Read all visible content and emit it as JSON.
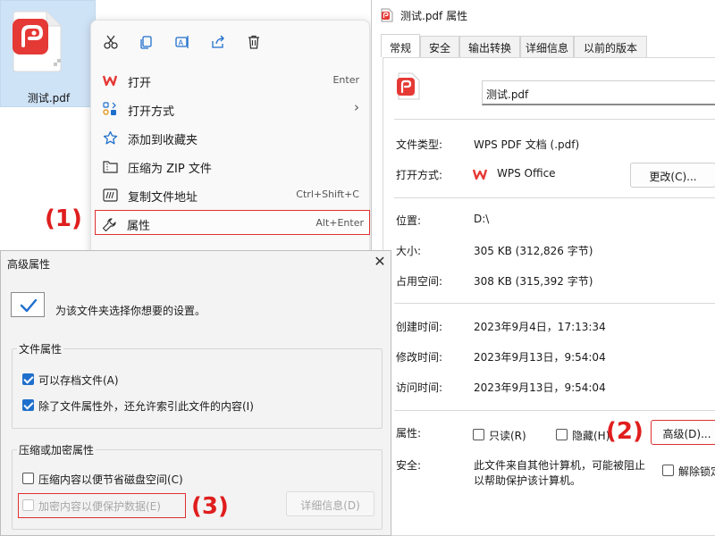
{
  "desktop": {
    "file_name": "测试.pdf"
  },
  "context_menu": {
    "toolbar_icons": [
      "cut-icon",
      "copy-icon",
      "rename-icon",
      "share-icon",
      "delete-icon"
    ],
    "items": [
      {
        "label": "打开",
        "shortcut": "Enter",
        "icon": "wps-icon"
      },
      {
        "label": "打开方式",
        "shortcut": "",
        "icon": "open-with-icon",
        "submenu_arrow": "›"
      },
      {
        "label": "添加到收藏夹",
        "shortcut": "",
        "icon": "star-icon"
      },
      {
        "label": "压缩为 ZIP 文件",
        "shortcut": "",
        "icon": "zip-folder-icon"
      },
      {
        "label": "复制文件地址",
        "shortcut": "Ctrl+Shift+C",
        "icon": "copy-path-icon"
      },
      {
        "label": "属性",
        "shortcut": "Alt+Enter",
        "icon": "wrench-icon"
      }
    ]
  },
  "annotations": {
    "a1": "(1)",
    "a2": "(2)",
    "a3": "(3)"
  },
  "properties_dialog": {
    "title": "测试.pdf 属性",
    "tabs": [
      "常规",
      "安全",
      "输出转换",
      "详细信息",
      "以前的版本"
    ],
    "active_tab": "常规",
    "file_name": "测试.pdf",
    "type_label": "文件类型:",
    "type_value": "WPS PDF 文档 (.pdf)",
    "open_with_label": "打开方式:",
    "open_with_app": "WPS Office",
    "change_button": "更改(C)...",
    "location_label": "位置:",
    "location_value": "D:\\",
    "size_label": "大小:",
    "size_value": "305 KB (312,826 字节)",
    "disk_size_label": "占用空间:",
    "disk_size_value": "308 KB (315,392 字节)",
    "created_label": "创建时间:",
    "created_value": "2023年9月4日，17:13:34",
    "modified_label": "修改时间:",
    "modified_value": "2023年9月13日，9:54:04",
    "accessed_label": "访问时间:",
    "accessed_value": "2023年9月13日，9:54:04",
    "attributes_label": "属性:",
    "readonly_label": "只读(R)",
    "hidden_label": "隐藏(H)",
    "advanced_button": "高级(D)...",
    "security_label": "安全:",
    "security_text_1": "此文件来自其他计算机，可能被阻止",
    "security_text_2": "以帮助保护该计算机。",
    "unblock_label": "解除锁定(K)"
  },
  "advanced_dialog": {
    "title": "高级属性",
    "close_glyph": "✕",
    "description": "为该文件夹选择你想要的设置。",
    "file_attributes_group": "文件属性",
    "archive_label": "可以存档文件(A)",
    "archive_checked": true,
    "index_label": "除了文件属性外，还允许索引此文件的内容(I)",
    "index_checked": true,
    "compress_group": "压缩或加密属性",
    "compress_label": "压缩内容以便节省磁盘空间(C)",
    "compress_checked": false,
    "encrypt_label": "加密内容以便保护数据(E)",
    "encrypt_checked": false,
    "details_button": "详细信息(D)"
  },
  "colors": {
    "annotation_red": "#e01e1e",
    "wps_red": "#e53935",
    "checkbox_blue": "#1f6fcc"
  }
}
